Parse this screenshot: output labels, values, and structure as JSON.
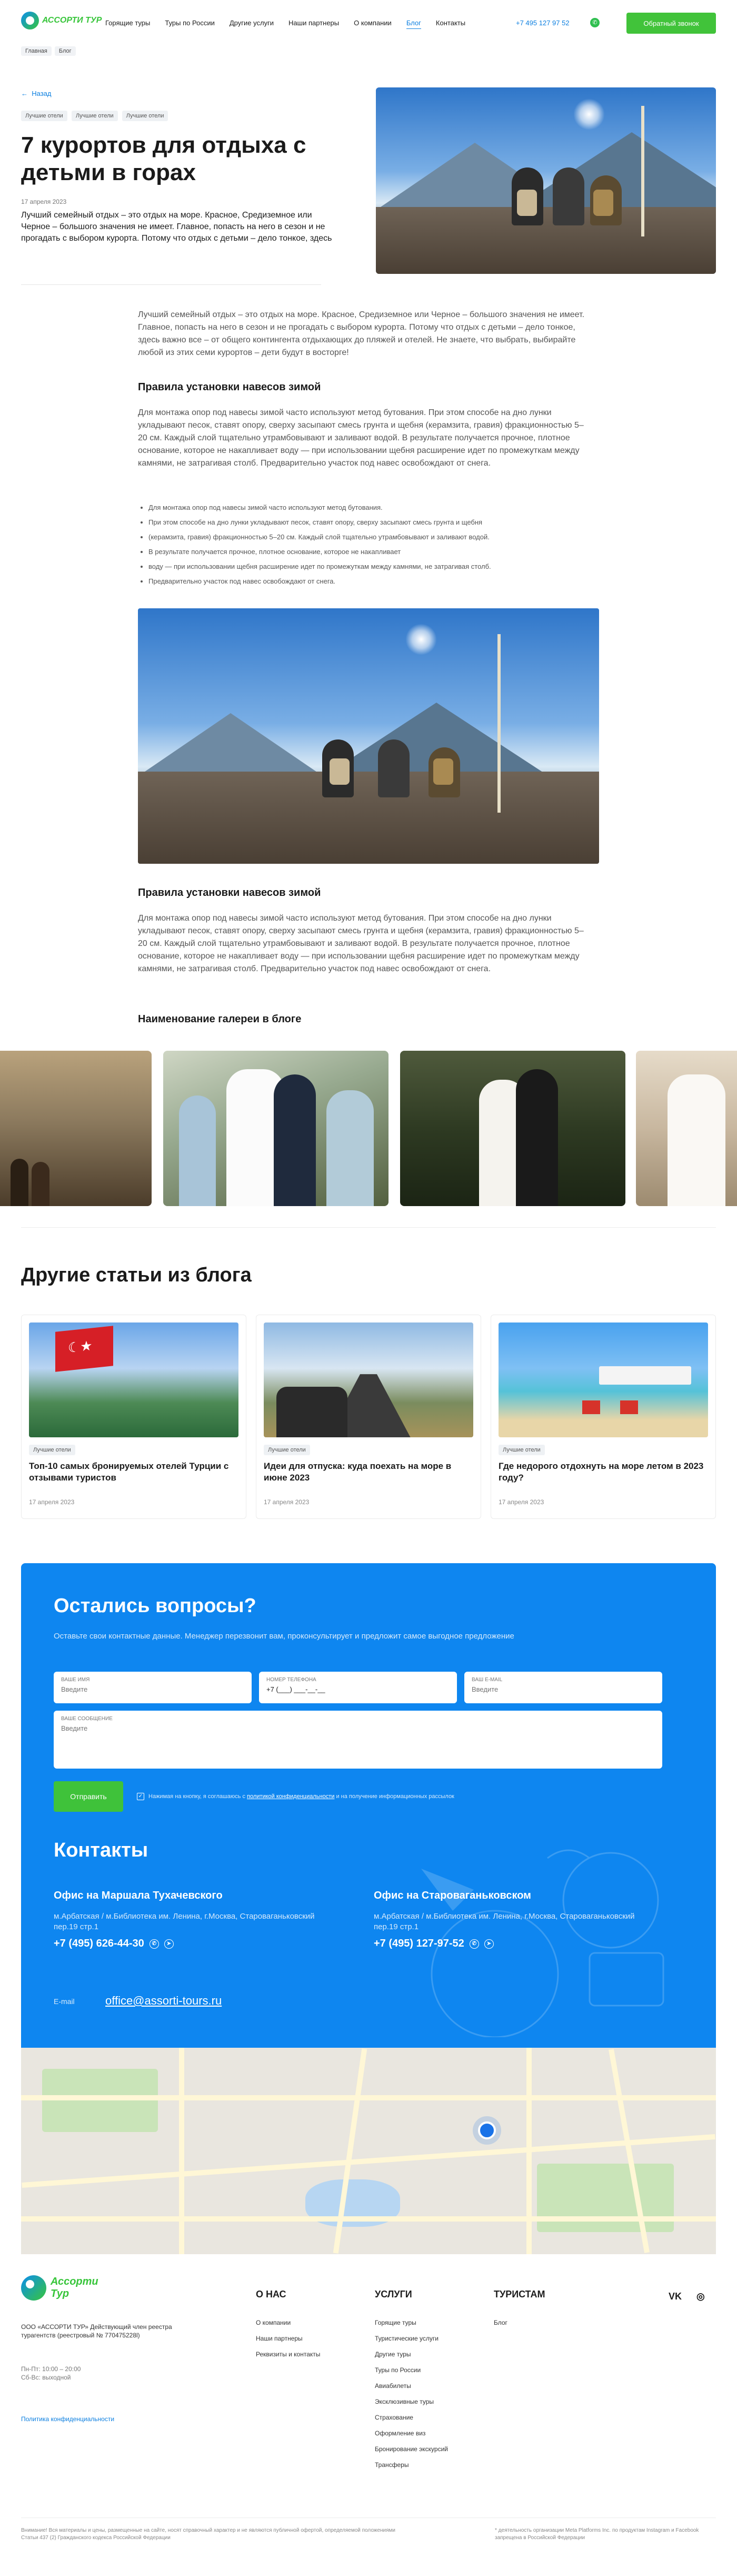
{
  "header": {
    "logo_word_a": "АССОРТИ",
    "logo_word_b": "ТУР",
    "nav": [
      {
        "label": "Горящие туры",
        "active": false
      },
      {
        "label": "Туры по России",
        "active": false
      },
      {
        "label": "Другие услуги",
        "active": false
      },
      {
        "label": "Наши партнеры",
        "active": false
      },
      {
        "label": "О компании",
        "active": false
      },
      {
        "label": "Блог",
        "active": true
      },
      {
        "label": "Контакты",
        "active": false
      }
    ],
    "phone": "+7 495 127 97 52",
    "callback_label": "Обратный звонок"
  },
  "breadcrumbs": [
    "Главная",
    "Блог"
  ],
  "hero": {
    "back_label": "Назад",
    "tags": [
      "Лучшие отели",
      "Лучшие отели",
      "Лучшие отели"
    ],
    "title": "7 курортов для отдыха с детьми в горах",
    "date": "17 апреля 2023",
    "lead": "Лучший семейный отдых – это отдых на море. Красное, Средиземное или Черное – большого значения не имеет. Главное, попасть на него в сезон и не прогадать с выбором курорта. Потому что отдых с детьми – дело тонкое, здесь"
  },
  "article": {
    "intro": "Лучший семейный отдых – это отдых на море. Красное, Средиземное или Черное – большого значения не имеет. Главное, попасть на него в сезон и не прогадать с выбором курорта. Потому что отдых с детьми – дело тонкое, здесь важно все – от общего контингента отдыхающих до пляжей и отелей. Не знаете, что выбрать, выбирайте любой из этих семи курортов – дети будут в восторге!",
    "section1_title": "Правила установки навесов зимой",
    "section1_text": "Для монтажа опор под навесы зимой часто используют метод бутования. При этом способе на дно лунки укладывают песок, ставят опору, сверху засыпают смесь грунта и щебня (керамзита, гравия) фракционностью 5–20 см. Каждый слой тщательно утрамбовывают и заливают водой. В результате получается прочное, плотное основание, которое не накапливает воду — при использовании щебня расширение идет по промежуткам между камнями, не затрагивая столб. Предварительно участок под навес освобождают от снега.",
    "bullets": [
      "Для монтажа опор под навесы зимой часто используют метод бутования.",
      "При этом способе на дно лунки укладывают песок, ставят опору, сверху засыпают смесь грунта и щебня",
      "(керамзита, гравия) фракционностью 5–20 см. Каждый слой тщательно утрамбовывают и заливают водой.",
      "В результате получается прочное, плотное основание, которое не накапливает",
      "воду — при использовании щебня расширение идет по промежуткам между камнями, не затрагивая столб.",
      "Предварительно участок под навес освобождают от снега."
    ],
    "section2_title": "Правила установки навесов зимой",
    "section2_text": "Для монтажа опор под навесы зимой часто используют метод бутования. При этом способе на дно лунки укладывают песок, ставят опору, сверху засыпают смесь грунта и щебня (керамзита, гравия) фракционностью 5–20 см. Каждый слой тщательно утрамбовывают и заливают водой. В результате получается прочное, плотное основание, которое не накапливает воду — при использовании щебня расширение идет по промежуткам между камнями, не затрагивая столб. Предварительно участок под навес освобождают от снега.",
    "gallery_title": "Наименование галереи в блоге"
  },
  "other": {
    "title": "Другие статьи из блога",
    "cards": [
      {
        "tag": "Лучшие отели",
        "title": "Топ-10 самых бронируемых отелей Турции с отзывами туристов",
        "date": "17 апреля 2023"
      },
      {
        "tag": "Лучшие отели",
        "title": "Идеи для отпуска: куда поехать на море в июне 2023",
        "date": "17 апреля 2023"
      },
      {
        "tag": "Лучшие отели",
        "title": "Где недорого отдохнуть на море летом в 2023 году?",
        "date": "17 апреля 2023"
      }
    ]
  },
  "contact": {
    "title": "Остались вопросы?",
    "subtitle": "Оставьте свои контактные данные. Менеджер перезвонит вам, проконсультирует и предложит самое выгодное предложение",
    "name_label": "Ваше имя",
    "name_placeholder": "Введите",
    "phone_label": "Номер телефона",
    "phone_value": "+7 (___) ___-__-__",
    "email_label": "Ваш e-mail",
    "email_placeholder": "Введите",
    "message_label": "Ваше сообщение",
    "message_placeholder": "Введите",
    "send_label": "Отправить",
    "agree_prefix": "Нажимая на кнопку, я соглашаюсь с",
    "agree_link": "политикой конфиденциальности",
    "agree_suffix": "и на получение информационных рассылок",
    "contacts_title": "Контакты",
    "offices": [
      {
        "name": "Офис на Маршала Тухачевского",
        "address": "м.Арбатская / м.Библиотека им. Ленина, г.Москва, Староваганьковский пер.19 стр.1",
        "phone": "+7 (495) 626-44-30"
      },
      {
        "name": "Офис на Староваганьковском",
        "address": "м.Арбатская / м.Библиотека им. Ленина, г.Москва, Староваганьковский пер.19 стр.1",
        "phone": "+7 (495) 127-97-52"
      }
    ],
    "email_caption": "E-mail",
    "email": "office@assorti-tours.ru"
  },
  "footer": {
    "logo_word_a": "Ассорти",
    "logo_word_b": "Тур",
    "company": "ООО «АССОРТИ ТУР» Действующий член реестра турагентств (реестровый № 770475228l)",
    "hours_1": "Пн-Пт: 10:00 – 20:00",
    "hours_2": "Сб-Вс: выходной",
    "privacy": "Политика конфиденциальности",
    "col_about": {
      "title": "О НАС",
      "items": [
        "О компании",
        "Наши партнеры",
        "Реквизиты и контакты"
      ]
    },
    "col_services": {
      "title": "УСЛУГИ",
      "items": [
        "Горящие туры",
        "Туристические услуги",
        "Другие туры",
        "Туры по России",
        "Авиабилеты",
        "Эксклюзивные туры",
        "Страхование",
        "Оформление виз",
        "Бронирование экскурсий",
        "Трансферы"
      ]
    },
    "col_tourists": {
      "title": "ТУРИСТАМ",
      "items": [
        "Блог"
      ]
    },
    "social_vk": "VK",
    "disclaimer": "Внимание! Вся материалы и цены, размещенные на сайте, носят справочный характер и не являются публичной офертой, определяемой положениями Статьи 437 (2) Гражданского кодекса Российской Федерации",
    "meta": "* деятельность организации Meta Platforms Inc. по продуктам Instagram и Facebook запрещена в Российской Федерации"
  },
  "colors": {
    "accent_blue": "#0e86f0",
    "accent_green": "#41c33a"
  }
}
